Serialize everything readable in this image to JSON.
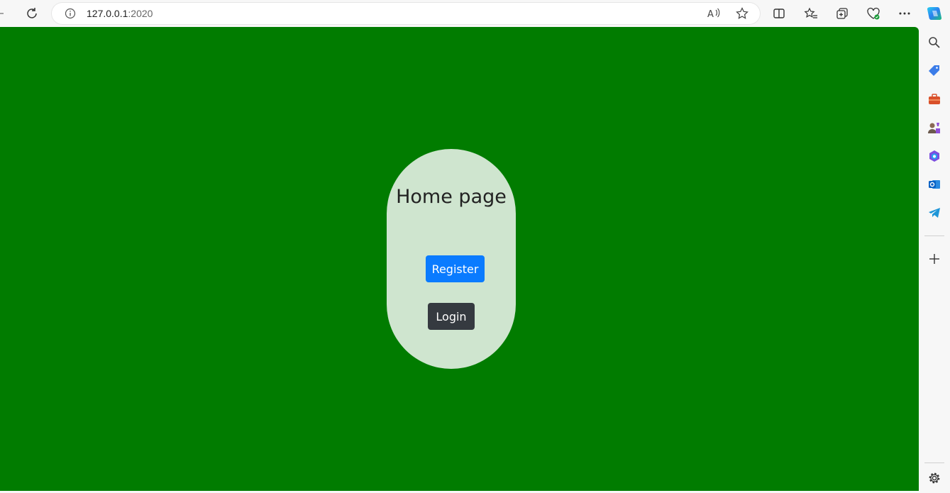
{
  "browser": {
    "url_host": "127.0.0.1",
    "url_port": ":2020",
    "toolbar_icons": [
      "back-icon",
      "refresh-icon",
      "info-icon",
      "read-aloud-icon",
      "favorite-star-icon",
      "split-screen-icon",
      "favorites-icon",
      "collections-icon",
      "browser-essentials-icon",
      "more-icon",
      "copilot-icon"
    ],
    "sidebar_icons": [
      "search-icon",
      "shopping-tag-icon",
      "tools-icon",
      "games-icon",
      "microsoft365-icon",
      "outlook-icon",
      "telegram-icon",
      "add-icon",
      "settings-icon"
    ]
  },
  "page": {
    "background": "#017c00",
    "card_color": "#cfe5cf",
    "title": "Home page",
    "register_label": "Register",
    "register_color": "#0a7bff",
    "login_label": "Login",
    "login_color": "#353a40"
  }
}
